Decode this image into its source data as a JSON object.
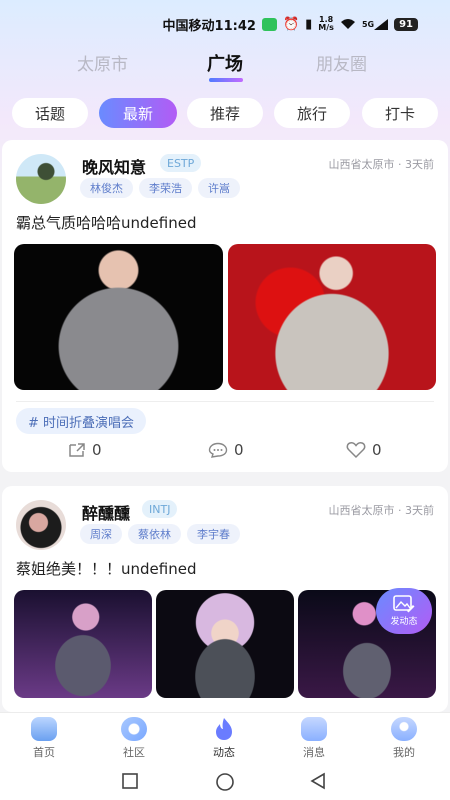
{
  "status_bar": {
    "carrier_time": "中国移动11:42",
    "network_speed_value": "1.8",
    "network_speed_unit": "M/s",
    "signal": "5G",
    "battery": "91"
  },
  "top_tabs": [
    {
      "label": "太原市",
      "active": false
    },
    {
      "label": "广场",
      "active": true
    },
    {
      "label": "朋友圈",
      "active": false
    }
  ],
  "chips": [
    {
      "label": "话题",
      "active": false
    },
    {
      "label": "最新",
      "active": true
    },
    {
      "label": "推荐",
      "active": false
    },
    {
      "label": "旅行",
      "active": false
    },
    {
      "label": "打卡",
      "active": false
    }
  ],
  "posts": [
    {
      "username": "晚风知意",
      "mbti": "ESTP",
      "location_time": "山西省太原市 · 3天前",
      "tags": [
        "林俊杰",
        "李荣浩",
        "许嵩"
      ],
      "text": "霸总气质哈哈哈undefined",
      "topic": "# 时间折叠演唱会",
      "shares": "0",
      "comments": "0",
      "likes": "0"
    },
    {
      "username": "醉醺醺",
      "mbti": "INTJ",
      "location_time": "山西省太原市 · 3天前",
      "tags": [
        "周深",
        "蔡依林",
        "李宇春"
      ],
      "text": "蔡姐绝美！！！undefined"
    }
  ],
  "fab": {
    "label": "发动态"
  },
  "bottom_nav": [
    {
      "label": "首页",
      "icon": "home-icon",
      "color": "#6aa0f0"
    },
    {
      "label": "社区",
      "icon": "community-icon",
      "color": "#7aa8ff"
    },
    {
      "label": "动态",
      "icon": "flame-icon",
      "color": "#6a7cff"
    },
    {
      "label": "消息",
      "icon": "message-icon",
      "color": "#8ab0ff"
    },
    {
      "label": "我的",
      "icon": "profile-icon",
      "color": "#8ab0ff"
    }
  ],
  "colors": {
    "accent_start": "#6a8bff",
    "accent_end": "#b25cf5",
    "tag_text": "#5d7ccb"
  }
}
